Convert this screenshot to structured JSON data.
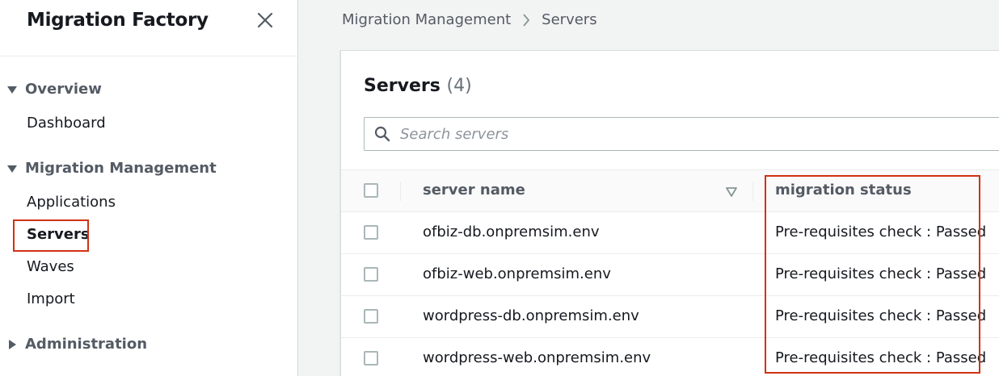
{
  "sidebar": {
    "title": "Migration Factory",
    "close_icon": "close-icon",
    "sections": [
      {
        "label": "Overview",
        "expanded": true,
        "items": [
          "Dashboard"
        ]
      },
      {
        "label": "Migration Management",
        "expanded": true,
        "items": [
          "Applications",
          "Servers",
          "Waves",
          "Import"
        ]
      },
      {
        "label": "Administration",
        "expanded": false,
        "items": []
      }
    ],
    "active_item": "Servers"
  },
  "breadcrumb": {
    "items": [
      "Migration Management",
      "Servers"
    ]
  },
  "panel": {
    "title": "Servers",
    "count": "(4)",
    "search": {
      "placeholder": "Search servers",
      "value": ""
    },
    "columns": [
      "server name",
      "migration status"
    ],
    "rows": [
      {
        "server_name": "ofbiz-db.onpremsim.env",
        "migration_status": "Pre-requisites check : Passed"
      },
      {
        "server_name": "ofbiz-web.onpremsim.env",
        "migration_status": "Pre-requisites check : Passed"
      },
      {
        "server_name": "wordpress-db.onpremsim.env",
        "migration_status": "Pre-requisites check : Passed"
      },
      {
        "server_name": "wordpress-web.onpremsim.env",
        "migration_status": "Pre-requisites check : Passed"
      }
    ]
  },
  "colors": {
    "highlight": "#d13212",
    "text": "#16191f",
    "muted": "#545b64"
  }
}
